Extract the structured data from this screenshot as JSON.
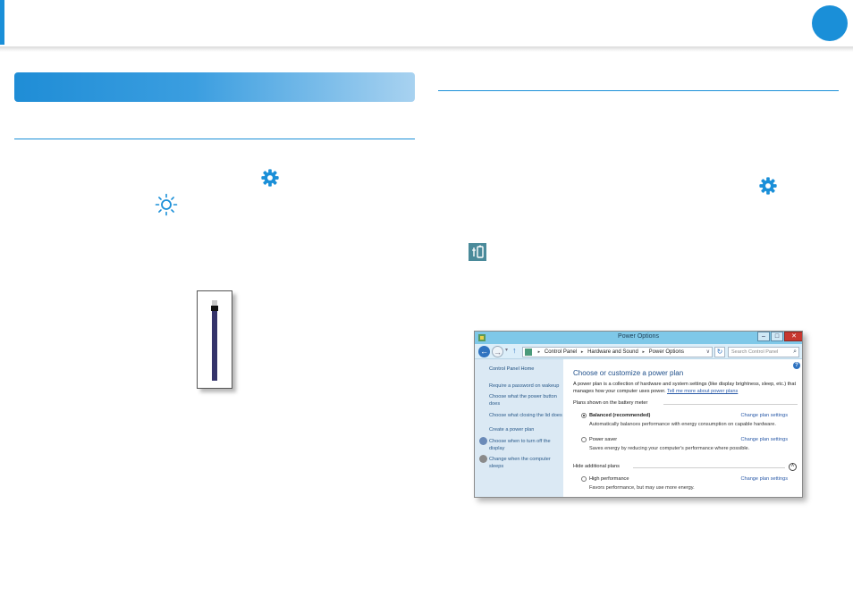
{
  "colors": {
    "accent": "#1a8fd8",
    "slider_fill": "#34336a",
    "window_title": "#7fc8e8"
  },
  "icons": {
    "settings_left": "gear-icon",
    "brightness": "sun-icon",
    "settings_right": "gear-icon",
    "battery": "battery-tile-icon"
  },
  "brightness_slider": {
    "level": 0.9
  },
  "window": {
    "title": "Power Options",
    "buttons": {
      "minimize": "–",
      "maximize": "□",
      "close": "✕"
    },
    "toolbar": {
      "back": "←",
      "forward": "→",
      "dropdown": "▾",
      "up": "↑",
      "breadcrumb": [
        "Control Panel",
        "Hardware and Sound",
        "Power Options"
      ],
      "separator": "▸",
      "address_dropdown": "∨",
      "refresh": "↻",
      "search_placeholder": "Search Control Panel",
      "search_icon": "⌕"
    },
    "sidebar": {
      "home": "Control Panel Home",
      "links": [
        "Require a password on wakeup",
        "Choose what the power button does",
        "Choose what closing the lid does",
        "Create a power plan",
        "Choose when to turn off the display",
        "Change when the computer sleeps"
      ]
    },
    "main": {
      "help": "?",
      "heading": "Choose or customize a power plan",
      "description": "A power plan is a collection of hardware and system settings (like display brightness, sleep, etc.) that manages how your computer uses power.",
      "description_link": "Tell me more about power plans",
      "group_battery_meter": "Plans shown on the battery meter",
      "group_hidden": "Hide additional plans",
      "collapse": "˄",
      "plans": [
        {
          "name": "Balanced (recommended)",
          "selected": true,
          "desc": "Automatically balances performance with energy consumption on capable hardware.",
          "link": "Change plan settings"
        },
        {
          "name": "Power saver",
          "selected": false,
          "desc": "Saves energy by reducing your computer's performance where possible.",
          "link": "Change plan settings"
        },
        {
          "name": "High performance",
          "selected": false,
          "desc": "Favors performance, but may use more energy.",
          "link": "Change plan settings"
        }
      ]
    }
  }
}
